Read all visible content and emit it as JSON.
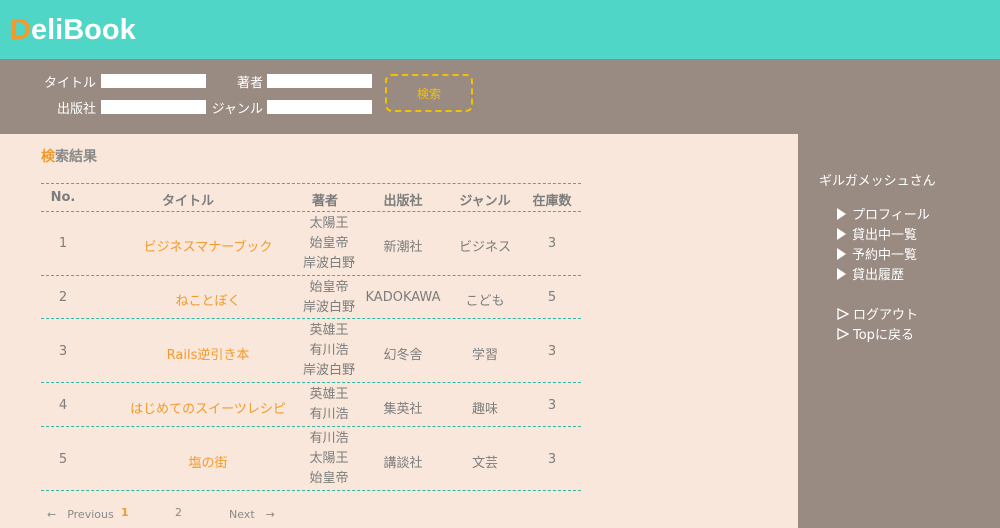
{
  "app": {
    "logo_initial": "D",
    "logo_rest": "eliBook"
  },
  "search": {
    "title_label": "タイトル",
    "author_label": "著者",
    "publisher_label": "出版社",
    "genre_label": "ジャンル",
    "title_value": "",
    "author_value": "",
    "publisher_value": "",
    "genre_value": "",
    "button_label": "検索"
  },
  "results": {
    "heading_first": "検",
    "heading_rest": "索結果",
    "columns": [
      "No.",
      "タイトル",
      "著者",
      "出版社",
      "ジャンル",
      "在庫数"
    ],
    "rows": [
      {
        "no": "1",
        "title": "ビジネスマナーブック",
        "authors": [
          "太陽王",
          "始皇帝",
          "岸波白野"
        ],
        "publisher": "新潮社",
        "genre": "ビジネス",
        "stock": "3"
      },
      {
        "no": "2",
        "title": "ねことぼく",
        "authors": [
          "始皇帝",
          "岸波白野"
        ],
        "publisher": "KADOKAWA",
        "genre": "こども",
        "stock": "5"
      },
      {
        "no": "3",
        "title": "Rails逆引き本",
        "authors": [
          "英雄王",
          "有川浩",
          "岸波白野"
        ],
        "publisher": "幻冬舎",
        "genre": "学習",
        "stock": "3"
      },
      {
        "no": "4",
        "title": "はじめてのスイーツレシピ",
        "authors": [
          "英雄王",
          "有川浩"
        ],
        "publisher": "集英社",
        "genre": "趣味",
        "stock": "3"
      },
      {
        "no": "5",
        "title": "塩の街",
        "authors": [
          "有川浩",
          "太陽王",
          "始皇帝"
        ],
        "publisher": "講談社",
        "genre": "文芸",
        "stock": "3"
      }
    ]
  },
  "pagination": {
    "prev": "←　Previous",
    "page1": "1",
    "page2": "2",
    "next": "Next　→"
  },
  "sidebar": {
    "user": "ギルガメッシュさん",
    "menu": [
      "プロフィール",
      "貸出中一覧",
      "予約中一覧",
      "貸出履歴"
    ],
    "links": [
      "ログアウト",
      "Topに戻る"
    ]
  },
  "colors": {
    "header": "#4fd6c6",
    "accent": "#f39a2c",
    "panel": "#9a8b82",
    "content_bg": "#f8e7da",
    "button": "#f2c100",
    "divider": "#2fb8a6"
  }
}
